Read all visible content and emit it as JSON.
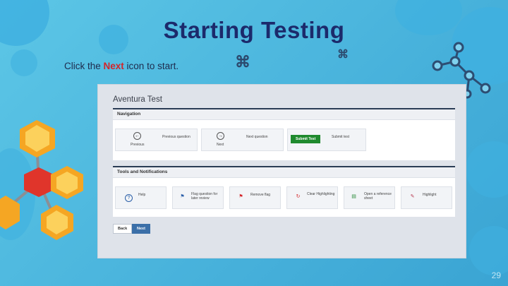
{
  "slide": {
    "title": "Starting Testing",
    "instruction_pre": "Click the ",
    "instruction_highlight": "Next",
    "instruction_post": " icon to start.",
    "page_number": "29"
  },
  "app": {
    "title": "Aventura Test",
    "navigation": {
      "heading": "Navigation",
      "previous_icon_label": "Previous",
      "previous_caption": "Previous question",
      "next_icon_label": "Next",
      "next_caption": "Next question",
      "submit_button": "Submit Test",
      "submit_caption": "Submit test"
    },
    "tools": {
      "heading": "Tools and Notifications",
      "items": [
        {
          "label": "Help",
          "icon": "help-icon",
          "glyph": "?"
        },
        {
          "label": "Flag question for later review",
          "icon": "flag-icon",
          "glyph": "⚑"
        },
        {
          "label": "Remove flag",
          "icon": "remove-flag-icon",
          "glyph": "⚑"
        },
        {
          "label": "Clear Highlighting",
          "icon": "refresh-icon",
          "glyph": "↻"
        },
        {
          "label": "Open a reference sheet",
          "icon": "reference-sheet-icon",
          "glyph": "▤"
        },
        {
          "label": "Highlight",
          "icon": "highlighter-icon",
          "glyph": "✎"
        }
      ]
    },
    "back_button": "Back",
    "next_button": "Next"
  },
  "colors": {
    "title": "#1c2a6b",
    "next_highlight": "#d3252a",
    "submit": "#1f8a2e",
    "next_button": "#3b6fa8",
    "panel_border": "#2a3c55"
  }
}
